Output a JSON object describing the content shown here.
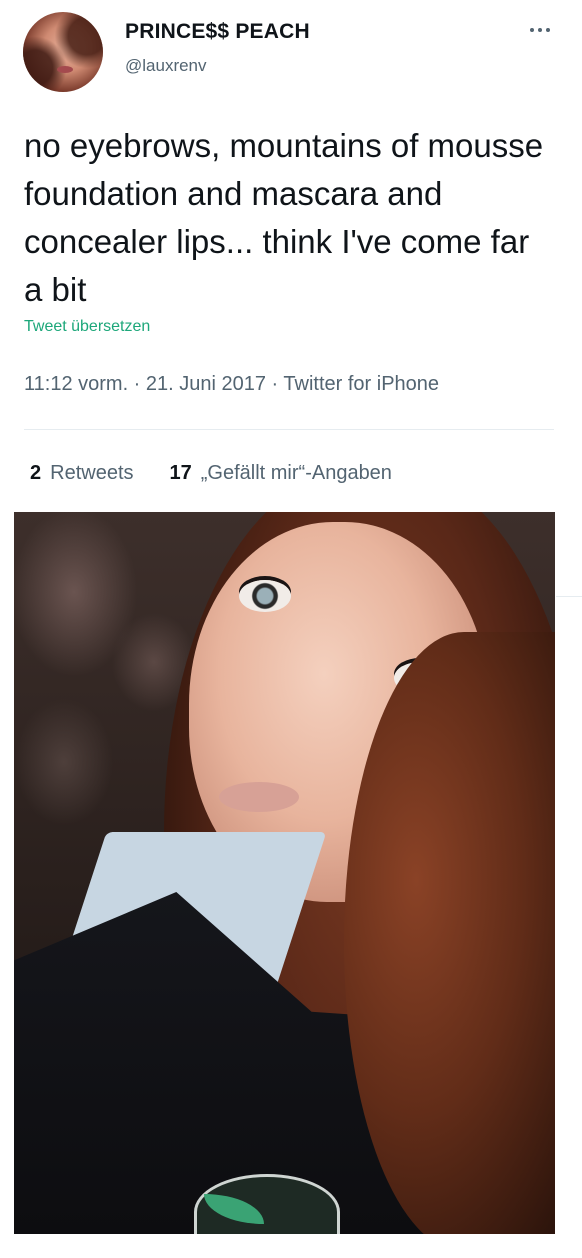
{
  "tweet": {
    "author": {
      "display_name": "PRINCE$$ PEACH",
      "handle": "@lauxrenv"
    },
    "text": "no eyebrows, mountains of mousse foundation and mascara and concealer lips... think I've come far a bit",
    "translate_label": "Tweet übersetzen",
    "meta": "11:12 vorm. · 21. Juni 2017 · Twitter for iPhone",
    "stats": {
      "retweets_count": "2",
      "retweets_label": "Retweets",
      "likes_count": "17",
      "likes_label": "„Gefällt mir“-Angaben"
    },
    "icons": {
      "more": "more-horizontal-icon"
    }
  }
}
